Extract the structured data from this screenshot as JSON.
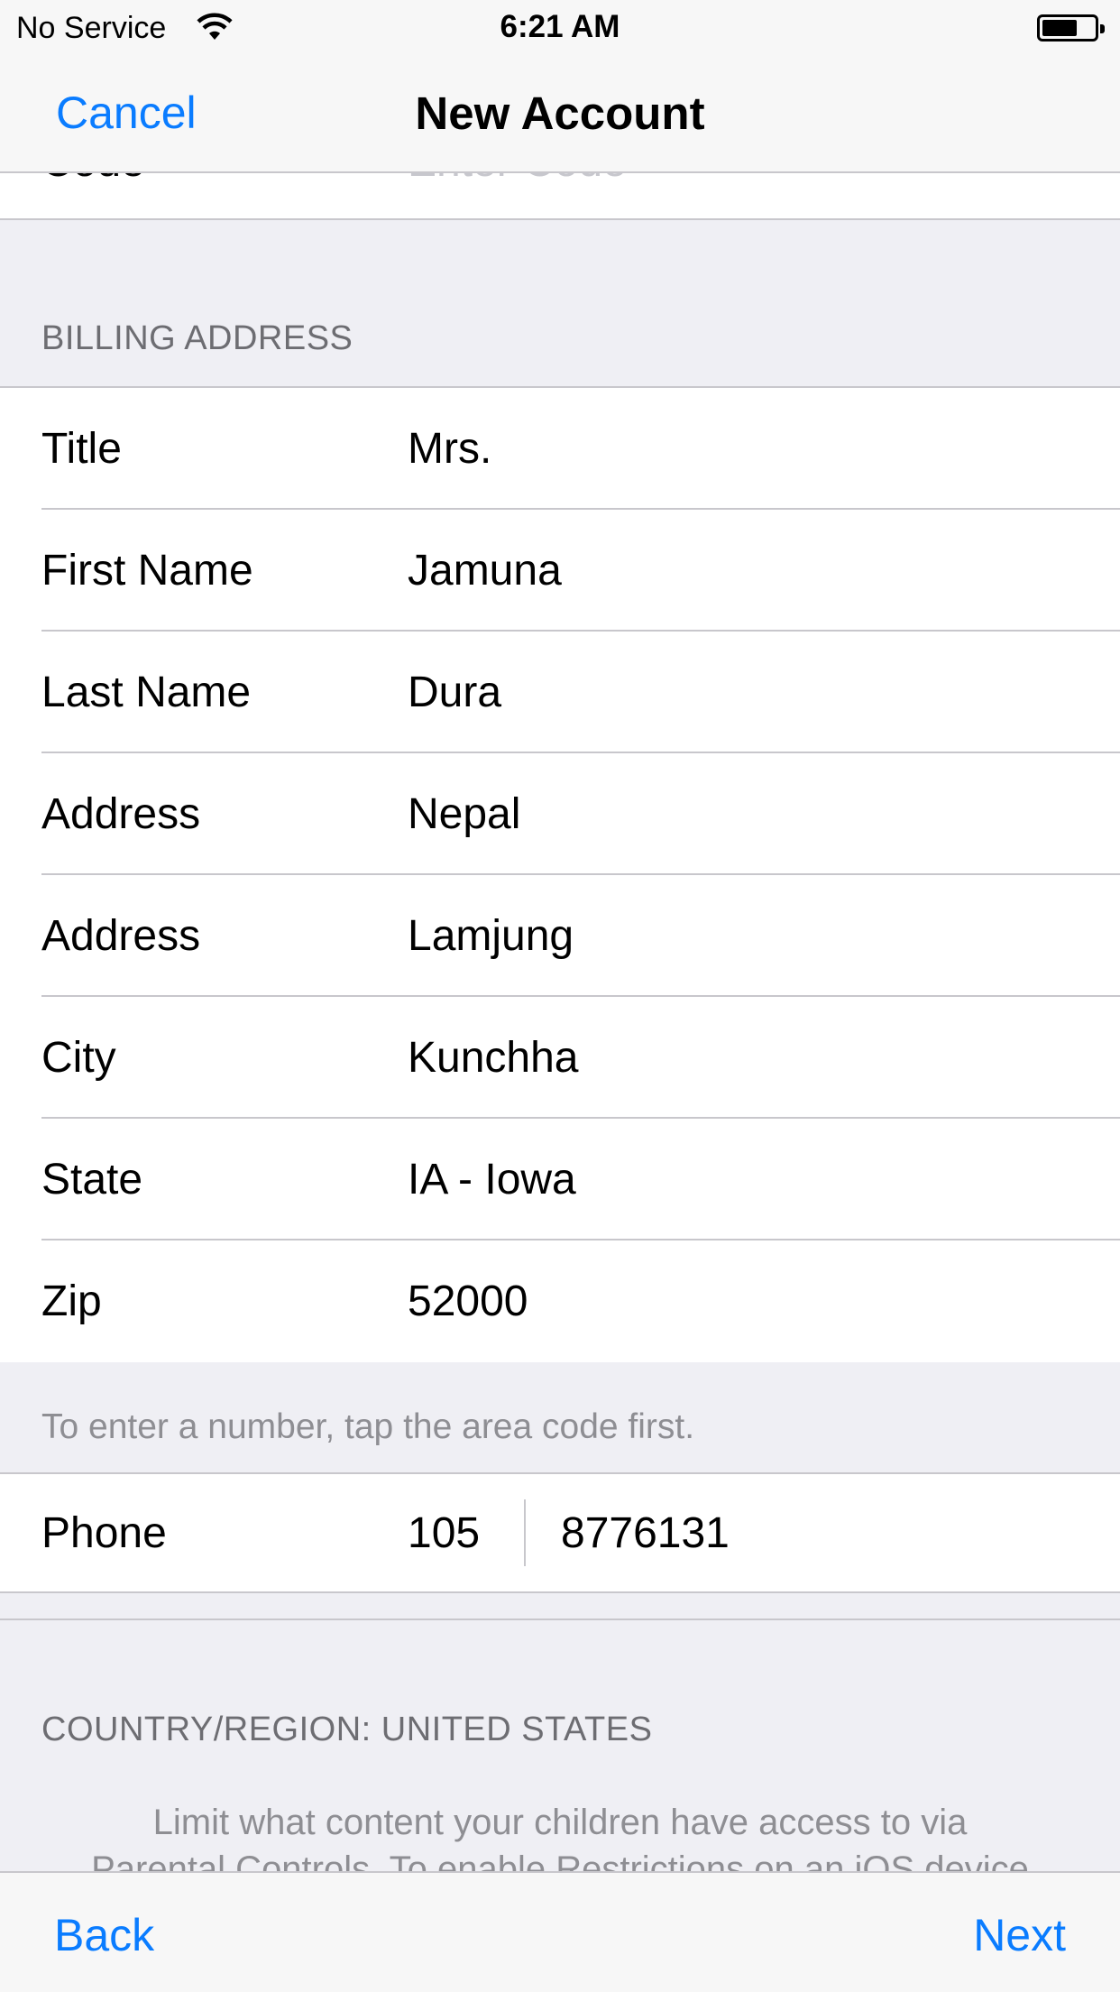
{
  "status_bar": {
    "carrier": "No Service",
    "time": "6:21 AM",
    "wifi_icon": "wifi-icon",
    "battery_icon": "battery-icon"
  },
  "nav": {
    "cancel_label": "Cancel",
    "title": "New Account"
  },
  "code_row": {
    "label": "Code",
    "placeholder": "Enter Code"
  },
  "billing": {
    "header": "BILLING ADDRESS",
    "rows": [
      {
        "label": "Title",
        "value": "Mrs."
      },
      {
        "label": "First Name",
        "value": "Jamuna"
      },
      {
        "label": "Last Name",
        "value": "Dura"
      },
      {
        "label": "Address",
        "value": "Nepal"
      },
      {
        "label": "Address",
        "value": "Lamjung"
      },
      {
        "label": "City",
        "value": "Kunchha"
      },
      {
        "label": "State",
        "value": "IA - Iowa"
      },
      {
        "label": "Zip",
        "value": "52000"
      }
    ]
  },
  "phone": {
    "hint": "To enter a number, tap the area code first.",
    "label": "Phone",
    "area_code": "105",
    "number": "8776131"
  },
  "country": {
    "header": "COUNTRY/REGION: UNITED STATES",
    "info_line1": "Limit what content your children have access to via",
    "info_line2": "Parental Controls. To enable Restrictions on an iOS device"
  },
  "toolbar": {
    "back_label": "Back",
    "next_label": "Next"
  },
  "colors": {
    "accent": "#0a7cff",
    "background": "#efeff4",
    "separator": "#c8c7cc",
    "secondary_text": "#8e8e93"
  }
}
